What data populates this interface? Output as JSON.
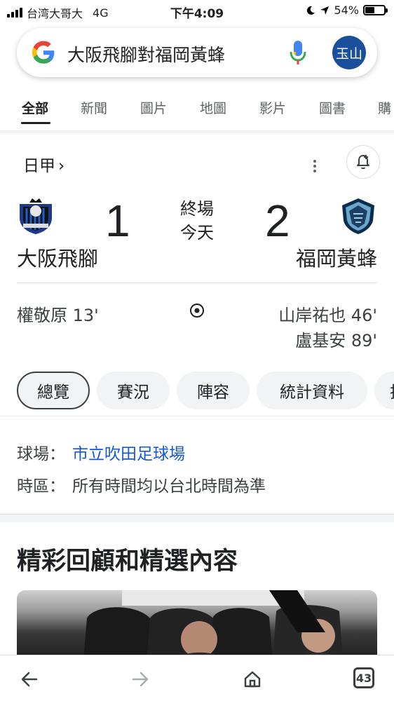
{
  "status_bar": {
    "carrier": "台湾大哥大",
    "network": "4G",
    "time": "下午4:09",
    "battery": "54%",
    "battery_level": 0.54
  },
  "search": {
    "query": "大阪飛腳對福岡黃蜂",
    "avatar_text": "玉山"
  },
  "tabs": [
    {
      "label": "全部",
      "active": true
    },
    {
      "label": "新聞"
    },
    {
      "label": "圖片"
    },
    {
      "label": "地圖"
    },
    {
      "label": "影片"
    },
    {
      "label": "圖書"
    },
    {
      "label": "購"
    }
  ],
  "match": {
    "league": "日甲",
    "league_chevron": "›",
    "status": "終場",
    "date": "今天",
    "home": {
      "name": "大阪飛腳",
      "score": "1",
      "scorers": [
        "權敬原 13'"
      ]
    },
    "away": {
      "name": "福岡黃蜂",
      "score": "2",
      "scorers": [
        "山岸祐也 46'",
        "盧基安 89'"
      ]
    }
  },
  "chips": [
    "總覽",
    "賽況",
    "陣容",
    "統計資料",
    "排"
  ],
  "info": {
    "venue_label": "球場：",
    "venue_value": "市立吹田足球場",
    "timezone_label": "時區：",
    "timezone_value": "所有時間均以台北時間為準"
  },
  "highlights": {
    "title": "精彩回顧和精選內容"
  },
  "bottom_nav": {
    "tab_count": "43"
  },
  "colors": {
    "link": "#1558d6",
    "avatar_bg": "#1a4f9c",
    "chip_bg": "#f1f3f4"
  }
}
